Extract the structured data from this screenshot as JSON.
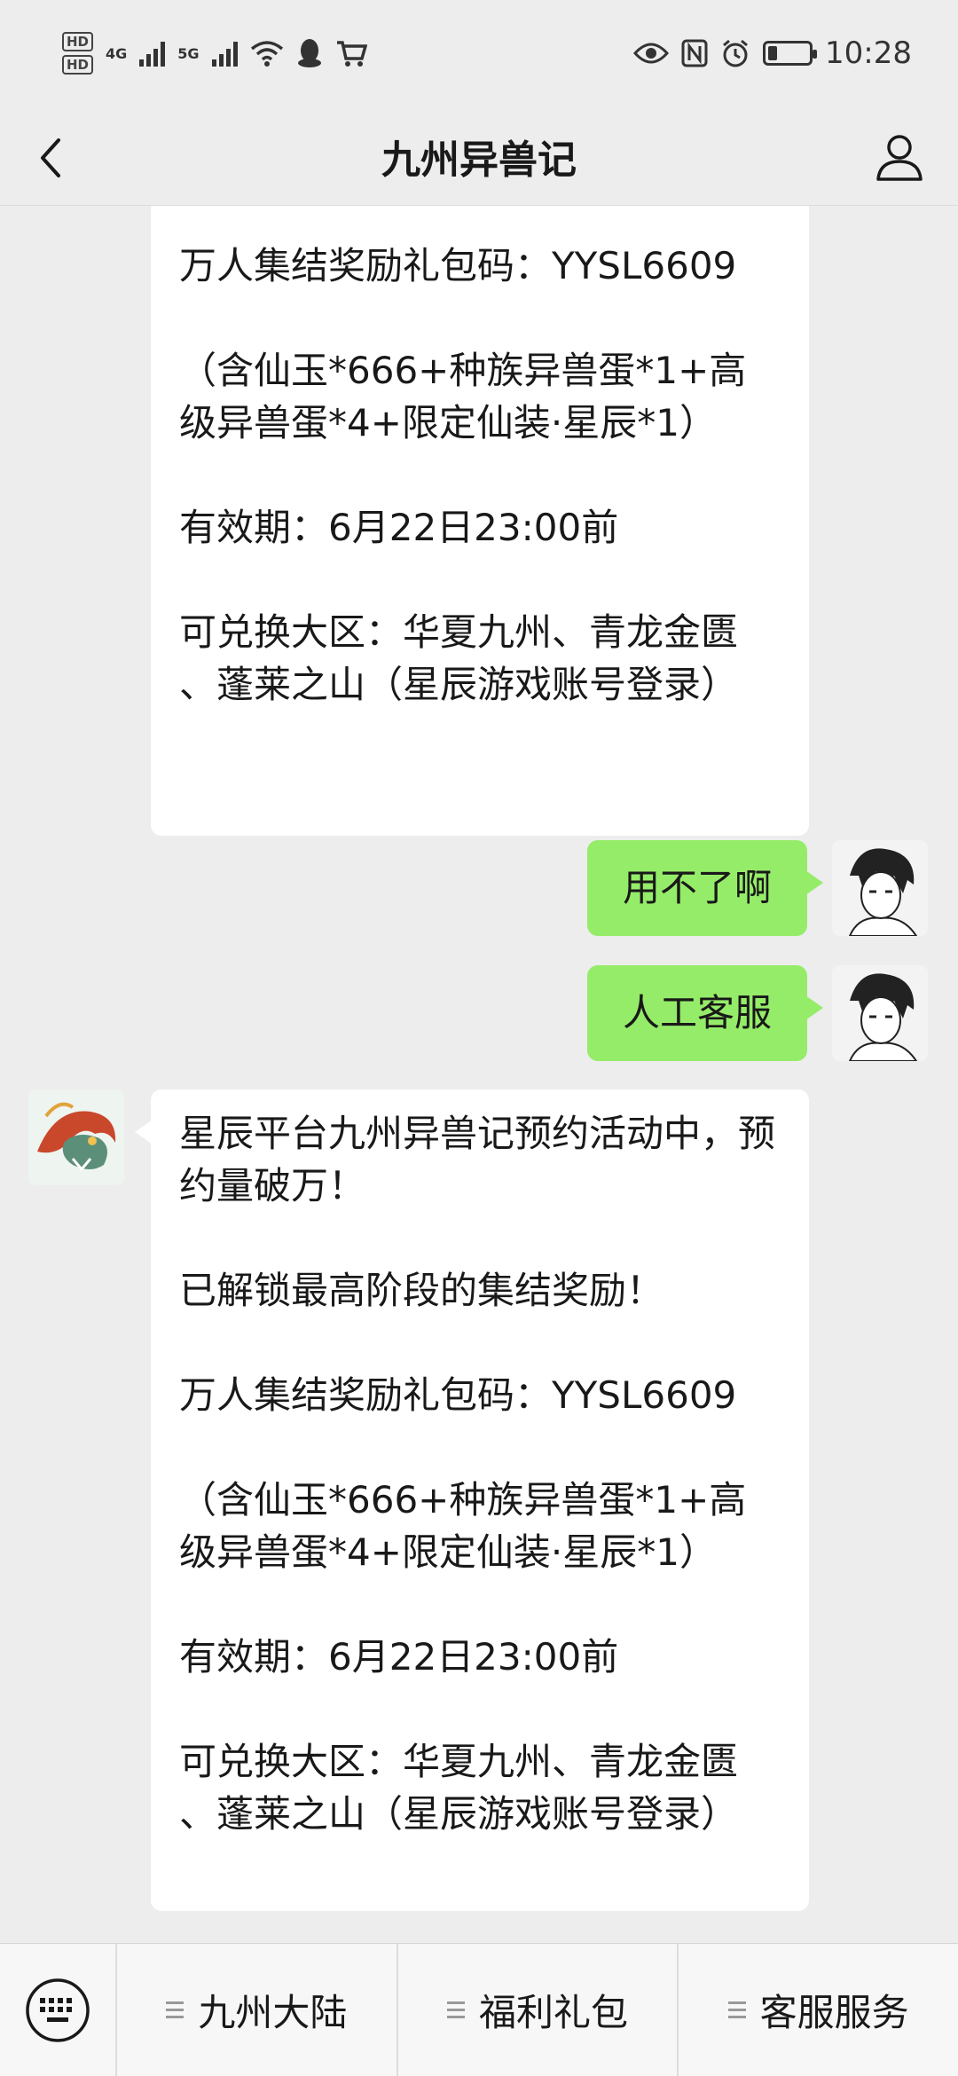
{
  "status_bar": {
    "network_left": "4G",
    "network_right": "5G",
    "hd1": "HD",
    "hd2": "HD",
    "time": "10:28"
  },
  "header": {
    "title": "九州异兽记"
  },
  "messages": [
    {
      "side": "left",
      "text": "已解锁最高阶段的集结奖励！\n\n万人集结奖励礼包码：YYSL6609\n\n（含仙玉*666+种族异兽蛋*1+高级异兽蛋*4+限定仙装·星辰*1）\n\n有效期：6月22日23:00前\n\n可兑换大区：华夏九州、青龙金匮 、蓬莱之山（星辰游戏账号登录）"
    },
    {
      "side": "right",
      "text": "用不了啊"
    },
    {
      "side": "right",
      "text": "人工客服"
    },
    {
      "side": "left",
      "text": "星辰平台九州异兽记预约活动中，预约量破万！\n\n已解锁最高阶段的集结奖励！\n\n万人集结奖励礼包码：YYSL6609\n\n（含仙玉*666+种族异兽蛋*1+高级异兽蛋*4+限定仙装·星辰*1）\n\n有效期：6月22日23:00前\n\n可兑换大区：华夏九州、青龙金匮 、蓬莱之山（星辰游戏账号登录）"
    }
  ],
  "bottom_menu": [
    {
      "label": "九州大陆"
    },
    {
      "label": "福利礼包"
    },
    {
      "label": "客服服务"
    }
  ],
  "colors": {
    "background": "#ededed",
    "bubble_self": "#95ec69",
    "bubble_other": "#ffffff"
  },
  "icons": {
    "back": "chevron-left-icon",
    "profile": "user-icon",
    "keyboard": "keyboard-icon"
  }
}
